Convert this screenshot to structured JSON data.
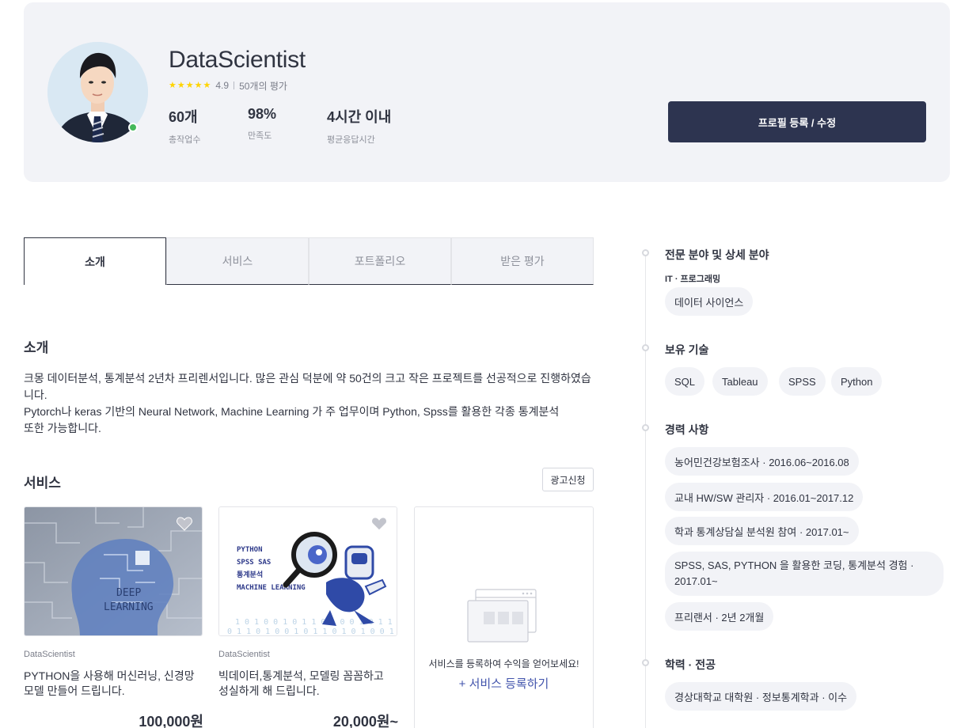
{
  "profile": {
    "name": "DataScientist",
    "rating": "4.9",
    "rating_stars": 5,
    "review_count": "50개의 평가",
    "stats": [
      {
        "value": "60개",
        "label": "총작업수"
      },
      {
        "value": "98%",
        "label": "만족도"
      },
      {
        "value": "4시간 이내",
        "label": "평균응답시간"
      }
    ],
    "edit_button": "프로필 등록 / 수정"
  },
  "tabs": [
    {
      "label": "소개",
      "active": true
    },
    {
      "label": "서비스",
      "active": false
    },
    {
      "label": "포트폴리오",
      "active": false
    },
    {
      "label": "받은 평가",
      "active": false
    }
  ],
  "intro": {
    "title": "소개",
    "lines": [
      "크몽 데이터분석, 통계분석 2년차 프리렌서입니다. 많은 관심 덕분에 약 50건의 크고 작은 프로젝트를 선공적으로 진행하였습니다.",
      "Pytorch나 keras 기반의 Neural Network, Machine Learning 가 주 업무이며 Python, Spss를 활용한 각종 통계분석",
      "또한 가능합니다."
    ]
  },
  "services": {
    "title": "서비스",
    "ad_button": "광고신청",
    "items": [
      {
        "seller": "DataScientist",
        "title": "PYTHON을 사용해 머신러닝, 신경망 모델 만들어 드립니다.",
        "price": "100,000원",
        "thumb_text": [
          "DEEP",
          "LEARNING"
        ]
      },
      {
        "seller": "DataScientist",
        "title": "빅데이터,통계분석, 모델링 꼼꼼하고 성실하게 해 드립니다.",
        "price": "20,000원~",
        "thumb_text": [
          "PYTHON",
          "SPSS SAS",
          "통계분석",
          "MACHINE LEARNING"
        ]
      }
    ],
    "empty": {
      "text": "서비스를 등록하여 수익을 얻어보세요!",
      "link": "+ 서비스 등록하기"
    }
  },
  "sidebar": {
    "expertise": {
      "title": "전문 분야 및 상세 분야",
      "category": "IT · 프로그래밍",
      "tags": [
        "데이터 사이언스"
      ]
    },
    "skills": {
      "title": "보유 기술",
      "tags": [
        "SQL",
        "Tableau",
        "SPSS",
        "Python"
      ]
    },
    "career": {
      "title": "경력 사항",
      "items": [
        "농어민건강보험조사 · 2016.06~2016.08",
        "교내 HW/SW 관리자 · 2016.01~2017.12",
        "학과 통계상담실 분석원 참여 · 2017.01~",
        "SPSS, SAS, PYTHON 을 활용한 코딩, 통계분석 경험 · 2017.01~",
        "프리랜서 · 2년 2개월"
      ]
    },
    "education": {
      "title": "학력 · 전공",
      "items": [
        "경상대학교 대학원 · 정보통계학과 · 이수"
      ]
    }
  },
  "colors": {
    "primary_button": "#2d3450",
    "card_background": "#f2f3f7",
    "star": "#ffd400",
    "link": "#4254ac",
    "online": "#44b95a"
  }
}
